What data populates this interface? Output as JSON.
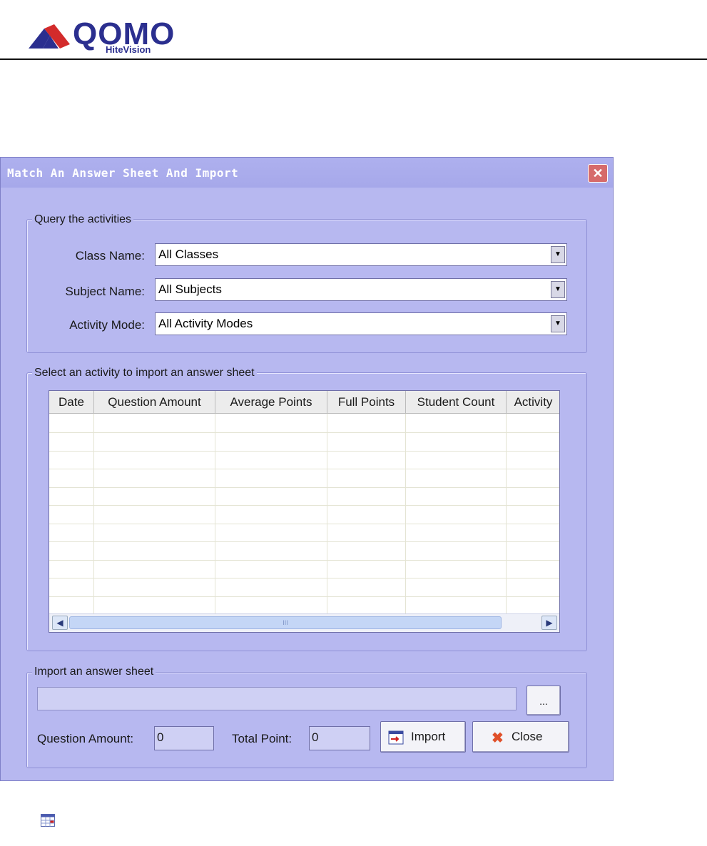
{
  "brand": {
    "name": "QOMO",
    "sub": "HiteVision"
  },
  "dialog": {
    "title": "Match An Answer Sheet And Import",
    "query_group": {
      "label": "Query the activities",
      "class_label": "Class Name:",
      "class_value": "All Classes",
      "subject_label": "Subject Name:",
      "subject_value": "All Subjects",
      "mode_label": "Activity Mode:",
      "mode_value": "All Activity Modes"
    },
    "select_group": {
      "label": "Select an activity to import an answer sheet",
      "columns": [
        "Date",
        "Question Amount",
        "Average Points",
        "Full Points",
        "Student Count",
        "Activity"
      ],
      "scroll_grip": "III"
    },
    "import_group": {
      "label": "Import an answer sheet",
      "browse_label": "...",
      "question_amount_label": "Question Amount:",
      "question_amount_value": "0",
      "total_point_label": "Total Point:",
      "total_point_value": "0",
      "import_label": "Import",
      "close_label": "Close"
    }
  },
  "colors": {
    "dialog_bg": "#b7b8f0",
    "title_text": "#ffffff",
    "close_button": "#d66b6b",
    "brand": "#2b2f8f"
  }
}
